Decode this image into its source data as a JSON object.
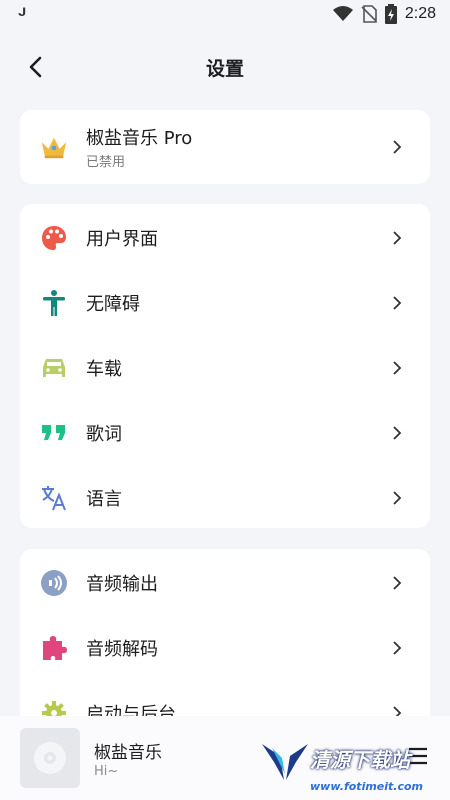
{
  "status_bar": {
    "left_glyph": "ᒍ",
    "time": "2:28"
  },
  "header": {
    "title": "设置"
  },
  "pro_card": {
    "label": "椒盐音乐 Pro",
    "status": "已禁用"
  },
  "group1": [
    {
      "label": "用户界面",
      "icon": "palette-icon",
      "color": "#ec5a4a"
    },
    {
      "label": "无障碍",
      "icon": "accessibility-icon",
      "color": "#12877b"
    },
    {
      "label": "车载",
      "icon": "car-icon",
      "color": "#b7cf66"
    },
    {
      "label": "歌词",
      "icon": "quote-icon",
      "color": "#20bf86"
    },
    {
      "label": "语言",
      "icon": "translate-icon",
      "color": "#5a7ad3"
    }
  ],
  "group2": [
    {
      "label": "音频输出",
      "icon": "speaker-icon",
      "color": "#8aa0c4"
    },
    {
      "label": "音频解码",
      "icon": "puzzle-icon",
      "color": "#e0457e"
    },
    {
      "label": "启动与后台",
      "icon": "gear-icon",
      "color": "#b8c94f"
    }
  ],
  "player": {
    "title": "椒盐音乐",
    "subtitle": "Hi~"
  },
  "watermark": {
    "text": "清源下载站",
    "url": "www.fotimeit.com"
  }
}
